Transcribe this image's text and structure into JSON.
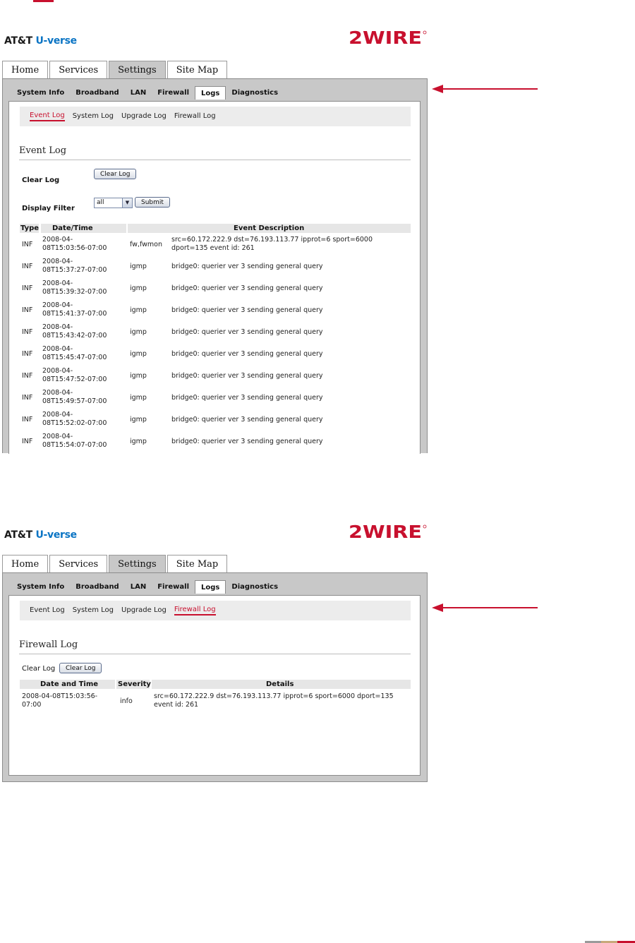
{
  "brand": {
    "att": "AT&T",
    "uverse": "U-verse",
    "logo": "2WIRE"
  },
  "main_tabs": [
    "Home",
    "Services",
    "Settings",
    "Site Map"
  ],
  "sub_tabs": [
    "System Info",
    "Broadband",
    "LAN",
    "Firewall",
    "Logs",
    "Diagnostics"
  ],
  "log_tabs": [
    "Event Log",
    "System Log",
    "Upgrade Log",
    "Firewall Log"
  ],
  "event_log": {
    "title": "Event Log",
    "clear_label": "Clear Log",
    "clear_button": "Clear Log",
    "filter_label": "Display Filter",
    "filter_value": "all",
    "submit_button": "Submit",
    "headers": [
      "Type",
      "Date/Time",
      "Event Description"
    ],
    "rows": [
      {
        "type": "INF",
        "date": "2008-04-\n08T15:03:56-07:00",
        "source": "fw,fwmon",
        "desc": "src=60.172.222.9 dst=76.193.113.77 ipprot=6 sport=6000\ndport=135 event id: 261"
      },
      {
        "type": "INF",
        "date": "2008-04-\n08T15:37:27-07:00",
        "source": "igmp",
        "desc": "bridge0: querier ver 3 sending general query"
      },
      {
        "type": "INF",
        "date": "2008-04-\n08T15:39:32-07:00",
        "source": "igmp",
        "desc": "bridge0: querier ver 3 sending general query"
      },
      {
        "type": "INF",
        "date": "2008-04-\n08T15:41:37-07:00",
        "source": "igmp",
        "desc": "bridge0: querier ver 3 sending general query"
      },
      {
        "type": "INF",
        "date": "2008-04-\n08T15:43:42-07:00",
        "source": "igmp",
        "desc": "bridge0: querier ver 3 sending general query"
      },
      {
        "type": "INF",
        "date": "2008-04-\n08T15:45:47-07:00",
        "source": "igmp",
        "desc": "bridge0: querier ver 3 sending general query"
      },
      {
        "type": "INF",
        "date": "2008-04-\n08T15:47:52-07:00",
        "source": "igmp",
        "desc": "bridge0: querier ver 3 sending general query"
      },
      {
        "type": "INF",
        "date": "2008-04-\n08T15:49:57-07:00",
        "source": "igmp",
        "desc": "bridge0: querier ver 3 sending general query"
      },
      {
        "type": "INF",
        "date": "2008-04-\n08T15:52:02-07:00",
        "source": "igmp",
        "desc": "bridge0: querier ver 3 sending general query"
      },
      {
        "type": "INF",
        "date": "2008-04-\n08T15:54:07-07:00",
        "source": "igmp",
        "desc": "bridge0: querier ver 3 sending general query"
      }
    ]
  },
  "firewall_log": {
    "title": "Firewall Log",
    "clear_label": "Clear Log",
    "clear_button": "Clear Log",
    "headers": [
      "Date and Time",
      "Severity",
      "Details"
    ],
    "rows": [
      {
        "date": "2008-04-08T15:03:56-\n07:00",
        "severity": "info",
        "details": "src=60.172.222.9 dst=76.193.113.77 ipprot=6 sport=6000 dport=135\nevent id: 261"
      }
    ]
  },
  "colors": {
    "accent_red": "#c8102e",
    "uverse_blue": "#0a74c4",
    "panel_gray": "#c8c8c8"
  }
}
